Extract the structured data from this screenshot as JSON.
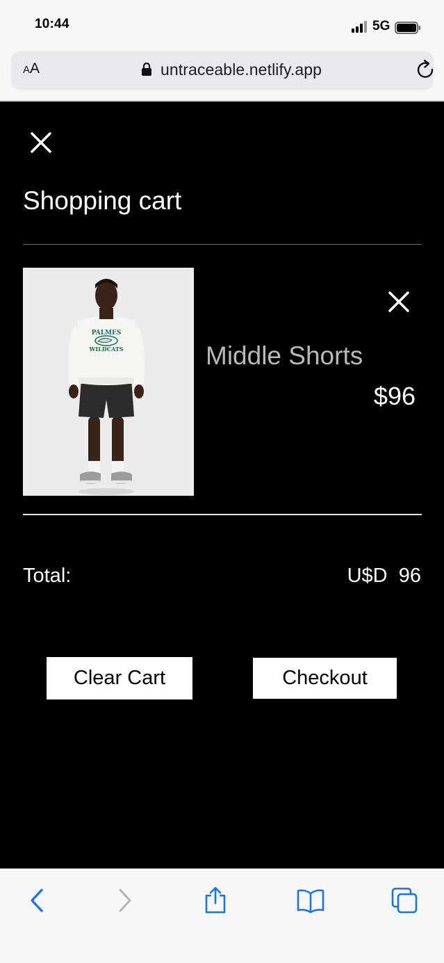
{
  "status_bar": {
    "time": "10:44",
    "network": "5G"
  },
  "browser": {
    "text_size_small": "A",
    "text_size_large": "A",
    "url": "untraceable.netlify.app",
    "accent_color": "#1a73e8"
  },
  "cart": {
    "title": "Shopping cart",
    "items": [
      {
        "name": "Middle Shorts",
        "price": "$96",
        "image_text_top": "PALMES",
        "image_text_bottom": "WILDCATS"
      }
    ],
    "total_label": "Total:",
    "total_currency": "U$D",
    "total_amount": "96",
    "clear_label": "Clear Cart",
    "checkout_label": "Checkout"
  },
  "icons": {
    "close": "close-icon",
    "remove": "close-icon",
    "back": "chevron-left-icon",
    "forward": "chevron-right-icon",
    "share": "share-icon",
    "bookmarks": "book-icon",
    "tabs": "tabs-icon",
    "reload": "reload-icon",
    "lock": "lock-icon"
  }
}
